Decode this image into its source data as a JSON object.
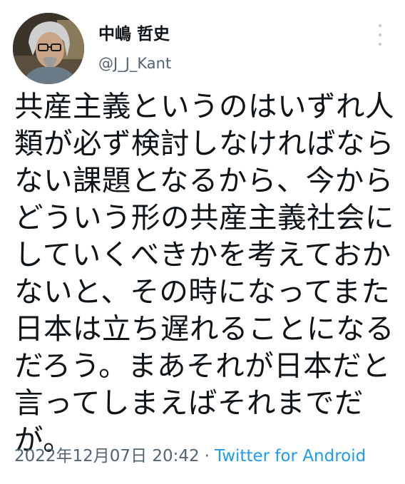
{
  "user": {
    "display_name": "中嶋 哲史",
    "handle": "@J_J_Kant"
  },
  "tweet": {
    "lines": [
      "共産主義というのはいずれ人",
      "類が必ず検討しなければなら",
      "ない課題となるから、今から",
      "どういう形の共産主義社会に",
      "していくべきかを考えておか",
      "ないと、その時になってまた",
      "日本は立ち遅れることになる",
      "だろう。まあそれが日本だと",
      "言ってしまえばそれまでだ",
      "が。"
    ],
    "timestamp": "2022年12月07日 20:42",
    "separator": "·",
    "source": "Twitter for Android"
  },
  "colors": {
    "text": "#0f1419",
    "secondary": "#536471",
    "link": "#1d9bf0"
  },
  "icons": {
    "more": "more-vertical-icon"
  }
}
